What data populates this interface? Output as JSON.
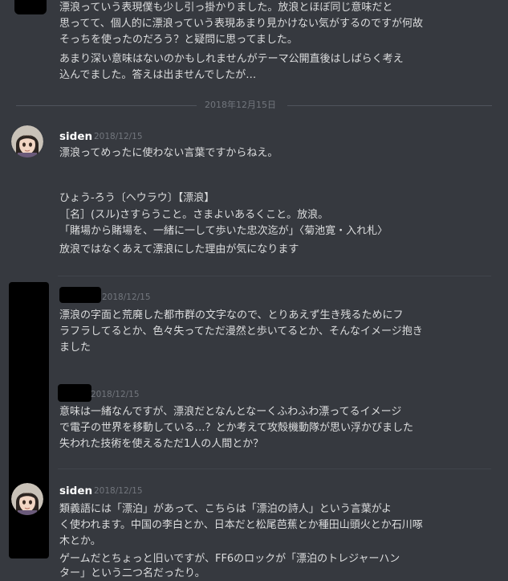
{
  "messages": {
    "continued": {
      "lines": [
        "漂浪っていう表現僕も少し引っ掛かりました。放浪とほぼ同じ意味だと",
        "思ってて、個人的に漂浪っていう表現あまり見かけない気がするのですが何故",
        "そっちを使ったのだろう？と疑問に思ってました。",
        "あまり深い意味はないのかもしれませんがテーマ公開直後はしばらく考え",
        "込んでました。答えは出ませんでしたが…"
      ]
    },
    "date_divider": "2018年12月15日",
    "siden1": {
      "author": "siden",
      "timestamp": "2018/12/15",
      "lines": [
        "漂浪ってめったに使わない言葉ですからねえ。",
        "",
        "ひょう-ろう〔ヘウラウ〕【漂浪】",
        "［名］(スル)さすらうこと。さまよいあるくこと。放浪。",
        "「賭場から賭場を、一緒に一して歩いた忠次迄が」〈菊池寛・入れ札〉",
        "放浪ではなくあえて漂浪にした理由が気になります"
      ]
    },
    "user2": {
      "timestamp": "2018/12/15",
      "lines": [
        "漂浪の字面と荒廃した都市群の文字なので、とりあえず生き残るためにフ",
        "ラフラしてるとか、色々失ってただ漫然と歩いてるとか、そんなイメージ抱き",
        "ました"
      ]
    },
    "user3": {
      "timestamp": "2018/12/15",
      "lines": [
        "意味は一緒なんですが、漂浪だとなんとなーくふわふわ漂ってるイメージ",
        "で電子の世界を移動している…？とか考えて攻殻機動隊が思い浮かびました",
        "失われた技術を使えるただ1人の人間とか？"
      ]
    },
    "siden2": {
      "author": "siden",
      "timestamp": "2018/12/15",
      "lines": [
        "類義語には「漂泊」があって、こちらは「漂泊の詩人」という言葉がよ",
        "く使われます。中国の李白とか、日本だと松尾芭蕉とか種田山頭火とか石川啄",
        "木とか。",
        "ゲームだとちょっと旧いですが、FF6のロックが「漂泊のトレジャーハン",
        "ター」という二つ名だったり。"
      ]
    }
  },
  "icons": {
    "siden_avatar": "anime-girl-avatar-icon",
    "redacted_avatar": "redacted-avatar-block"
  },
  "colors": {
    "background": "#36393f",
    "text": "#dcddde",
    "author": "#ffffff",
    "timestamp": "#72767d",
    "redaction": "#000000"
  }
}
